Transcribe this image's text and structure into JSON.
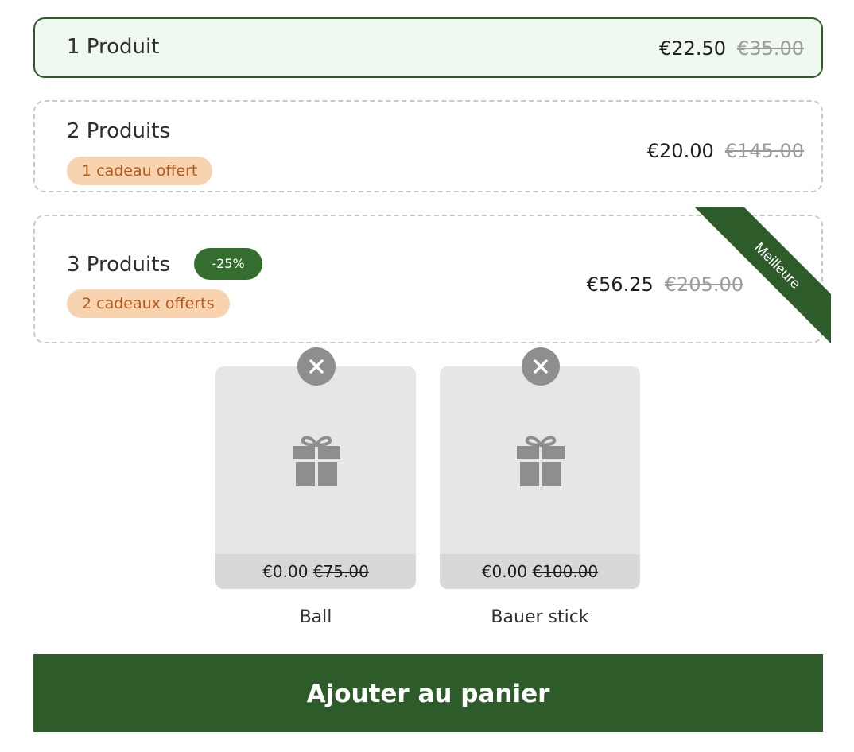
{
  "options": [
    {
      "title": "1 Produit",
      "price": "€22.50",
      "old_price": "€35.00",
      "selected": true
    },
    {
      "title": "2 Produits",
      "gift_badge": "1 cadeau offert",
      "price": "€20.00",
      "old_price": "€145.00"
    },
    {
      "title": "3 Produits",
      "discount": "-25%",
      "gift_badge": "2 cadeaux offerts",
      "price": "€56.25",
      "old_price": "€205.00",
      "ribbon": "Meilleure"
    }
  ],
  "gifts": [
    {
      "name": "Ball",
      "price": "€0.00",
      "old_price": "€75.00",
      "icon": "gift-icon"
    },
    {
      "name": "Bauer stick",
      "price": "€0.00",
      "old_price": "€100.00",
      "icon": "gift-icon"
    }
  ],
  "cta": {
    "label": "Ajouter au panier"
  },
  "colors": {
    "accent": "#2e5b2a",
    "selected_bg": "#eff9ef",
    "gift_badge_bg": "#f8d3b0",
    "gift_badge_text": "#b35a1b",
    "discount_bg": "#346e2f"
  }
}
